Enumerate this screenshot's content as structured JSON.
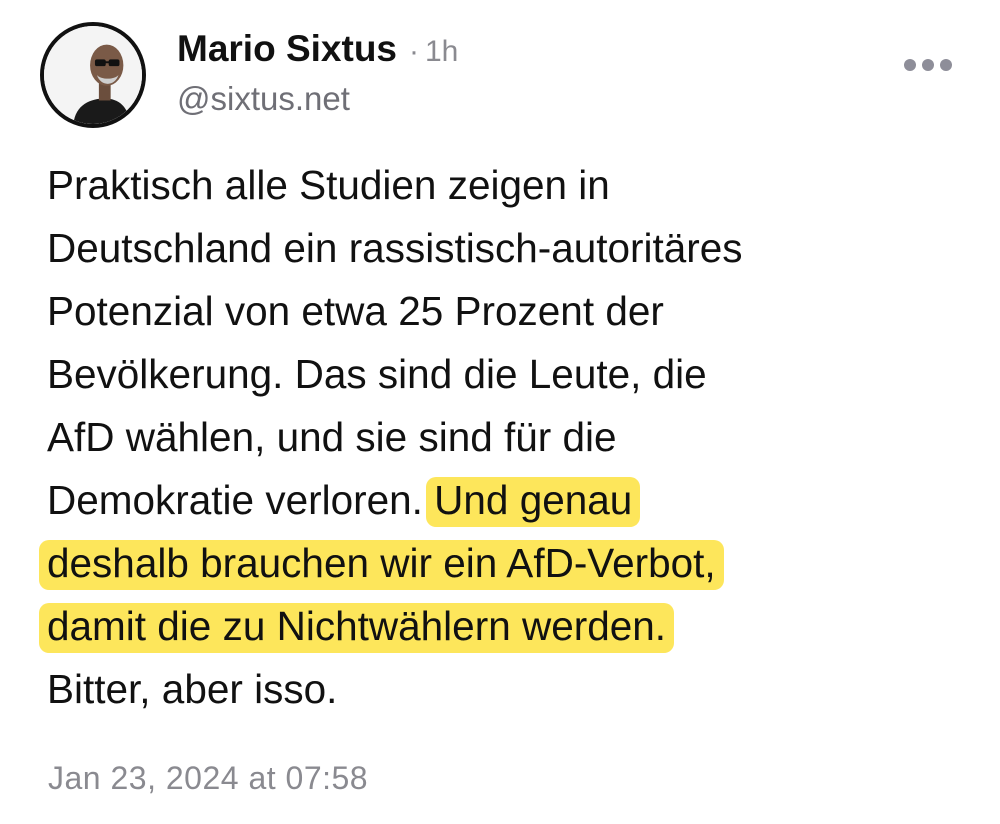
{
  "author": {
    "name": "Mario Sixtus",
    "separator": "·",
    "relative_time": "1h",
    "handle": "@sixtus.net"
  },
  "menu": {
    "icon": "more-options-icon"
  },
  "post": {
    "lines": [
      {
        "text": "Praktisch alle Studien zeigen in"
      },
      {
        "text": "Deutschland ein rassistisch-autoritäres"
      },
      {
        "text": "Potenzial von etwa 25 Prozent der"
      },
      {
        "text": "Bevölkerung. Das sind die Leute, die"
      },
      {
        "text": "AfD wählen, und sie sind für die"
      },
      {
        "text": "Demokratie verloren. ",
        "highlight": "Und genau"
      },
      {
        "highlight": "deshalb brauchen wir ein AfD-Verbot,"
      },
      {
        "highlight": "damit die zu Nichtwählern werden."
      },
      {
        "text": "Bitter, aber isso."
      }
    ]
  },
  "timestamp": "Jan 23, 2024 at 07:58",
  "colors": {
    "highlight": "#fde65b",
    "muted": "#8a8a90",
    "text": "#111111"
  }
}
